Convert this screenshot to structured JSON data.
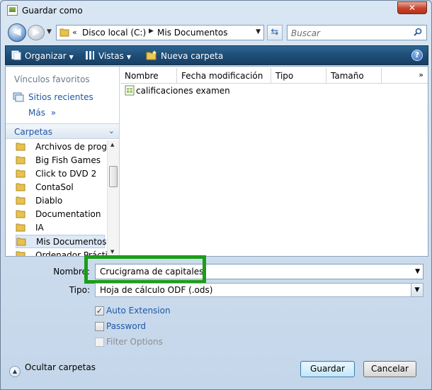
{
  "window": {
    "title": "Guardar como",
    "close_symbol": "✕"
  },
  "nav": {
    "back_symbol": "◀",
    "forward_symbol": "▶",
    "address_sep_start": "«",
    "address_segments": [
      "Disco local (C:)",
      "Mis Documentos"
    ],
    "address_sep": "▶",
    "search_placeholder": "Buscar"
  },
  "toolbar": {
    "organize_label": "Organizar",
    "views_label": "Vistas",
    "new_folder_label": "Nueva carpeta",
    "help_symbol": "?"
  },
  "sidebar": {
    "favorites_header": "Vínculos favoritos",
    "favorites": [
      {
        "label": "Sitios recientes"
      }
    ],
    "more_label": "Más",
    "more_symbol": "»",
    "folders_header": "Carpetas",
    "folders": [
      {
        "label": "Archivos de programa"
      },
      {
        "label": "Big Fish Games"
      },
      {
        "label": "Click to DVD 2"
      },
      {
        "label": "ContaSol"
      },
      {
        "label": "Diablo"
      },
      {
        "label": "Documentation"
      },
      {
        "label": "IA"
      },
      {
        "label": "Mis Documentos",
        "selected": true
      },
      {
        "label": "Ordenador Práctico"
      }
    ]
  },
  "file_list": {
    "columns": [
      "Nombre",
      "Fecha modificación",
      "Tipo",
      "Tamaño"
    ],
    "more_columns_symbol": "»",
    "files": [
      {
        "name": "calificaciones examen"
      }
    ]
  },
  "form": {
    "name_label": "Nombre:",
    "name_value": "Crucigrama de capitales",
    "type_label": "Tipo:",
    "type_value": "Hoja de cálculo ODF (.ods)",
    "options": [
      {
        "label": "Auto Extension",
        "checked": true,
        "enabled": true
      },
      {
        "label": "Password",
        "checked": false,
        "enabled": true
      },
      {
        "label": "Filter Options",
        "checked": false,
        "enabled": false
      }
    ],
    "hide_folders_label": "Ocultar carpetas",
    "save_label": "Guardar",
    "cancel_label": "Cancelar"
  },
  "colors": {
    "highlight": "#1a9e18",
    "link": "#1f57a5",
    "toolbar": "#1e4d77"
  }
}
